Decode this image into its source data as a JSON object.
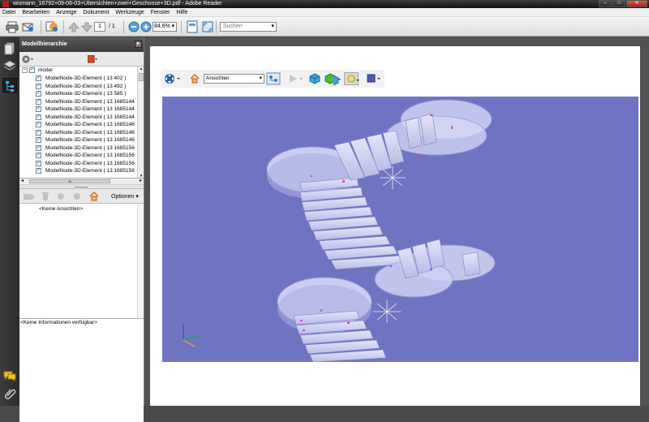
{
  "window": {
    "title": "wismann_16792+09-06-03+Übersichten+zwei+Geschosse+3D.pdf - Adobe Reader",
    "controls": [
      "–",
      "□",
      "✕"
    ]
  },
  "menu": [
    "Datei",
    "Bearbeiten",
    "Anzeige",
    "Dokument",
    "Werkzeuge",
    "Fenster",
    "Hilfe"
  ],
  "toolbar": {
    "page_current": "1",
    "page_total": "/ 1",
    "zoom": "84,6%",
    "search_placeholder": "Suchen"
  },
  "panel": {
    "title": "Modellhierarchie",
    "tree_root": "model",
    "tree_items": [
      "ModelNode-3D-Element ( 13 402 )",
      "ModelNode-3D-Element ( 13 492 )",
      "ModelNode-3D-Element ( 13 585 )",
      "ModelNode-3D-Element ( 13 1685144",
      "ModelNode-3D-Element ( 13 1685144",
      "ModelNode-3D-Element ( 13 1685144",
      "ModelNode-3D-Element ( 13 1685146",
      "ModelNode-3D-Element ( 13 1685146",
      "ModelNode-3D-Element ( 13 1685146",
      "ModelNode-3D-Element ( 13 1685156",
      "ModelNode-3D-Element ( 13 1685156",
      "ModelNode-3D-Element ( 13 1685156",
      "ModelNode-3D-Element ( 13 1685158"
    ],
    "hscroll_label": "III",
    "views_options": "Optionen",
    "no_views": "<Keine Ansichten>",
    "no_info": "<Keine Informationen verfügbar>"
  },
  "toolbar3d": {
    "views_label": "Ansichten"
  },
  "colors": {
    "viewport_bg": "#6f74c2",
    "accent_red": "#d44a2a",
    "magenta_marker": "#e040d0"
  },
  "icons": {
    "print": "printer-icon",
    "email": "email-icon",
    "collaborate": "collaborate-icon",
    "prev": "arrow-up-icon",
    "next": "arrow-down-icon",
    "zoom_out": "zoom-out-icon",
    "zoom_in": "zoom-in-icon",
    "fit": "fit-page-icon",
    "fullscreen": "fullscreen-icon",
    "pages": "pages-icon",
    "layers": "layers-icon",
    "model_tree": "model-tree-icon",
    "comments": "comments-icon",
    "attach": "paperclip-icon"
  }
}
